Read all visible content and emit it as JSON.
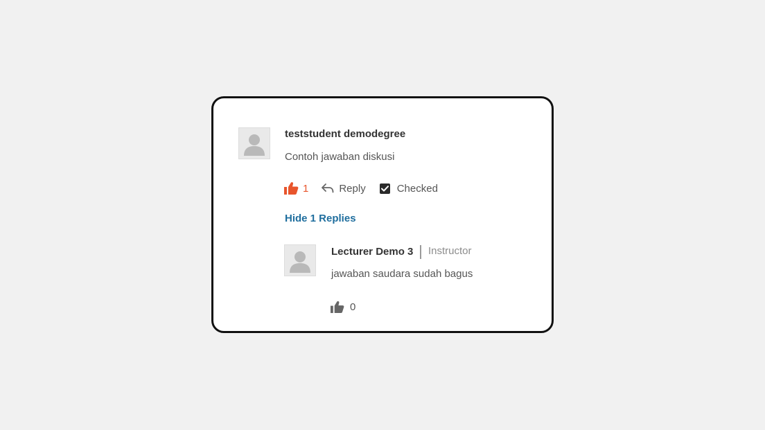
{
  "comment": {
    "author": "teststudent demodegree",
    "text": "Contoh jawaban diskusi",
    "likes": "1",
    "liked": true,
    "reply_label": "Reply",
    "checked_label": "Checked",
    "checked": true,
    "toggle_replies_label": "Hide 1 Replies"
  },
  "reply": {
    "author": "Lecturer Demo 3",
    "role": "Instructor",
    "text": "jawaban saudara sudah bagus",
    "likes": "0",
    "liked": false
  },
  "icons": {
    "avatar": "default-user-avatar",
    "like_active": "thumbs-up-icon",
    "like": "thumbs-up-icon",
    "reply": "reply-arrow-icon",
    "checked": "checkbox-checked-icon"
  },
  "colors": {
    "like_active": "#e8552c",
    "link": "#1f6e9e",
    "card_border": "#111111",
    "background": "#f1f1f1"
  }
}
